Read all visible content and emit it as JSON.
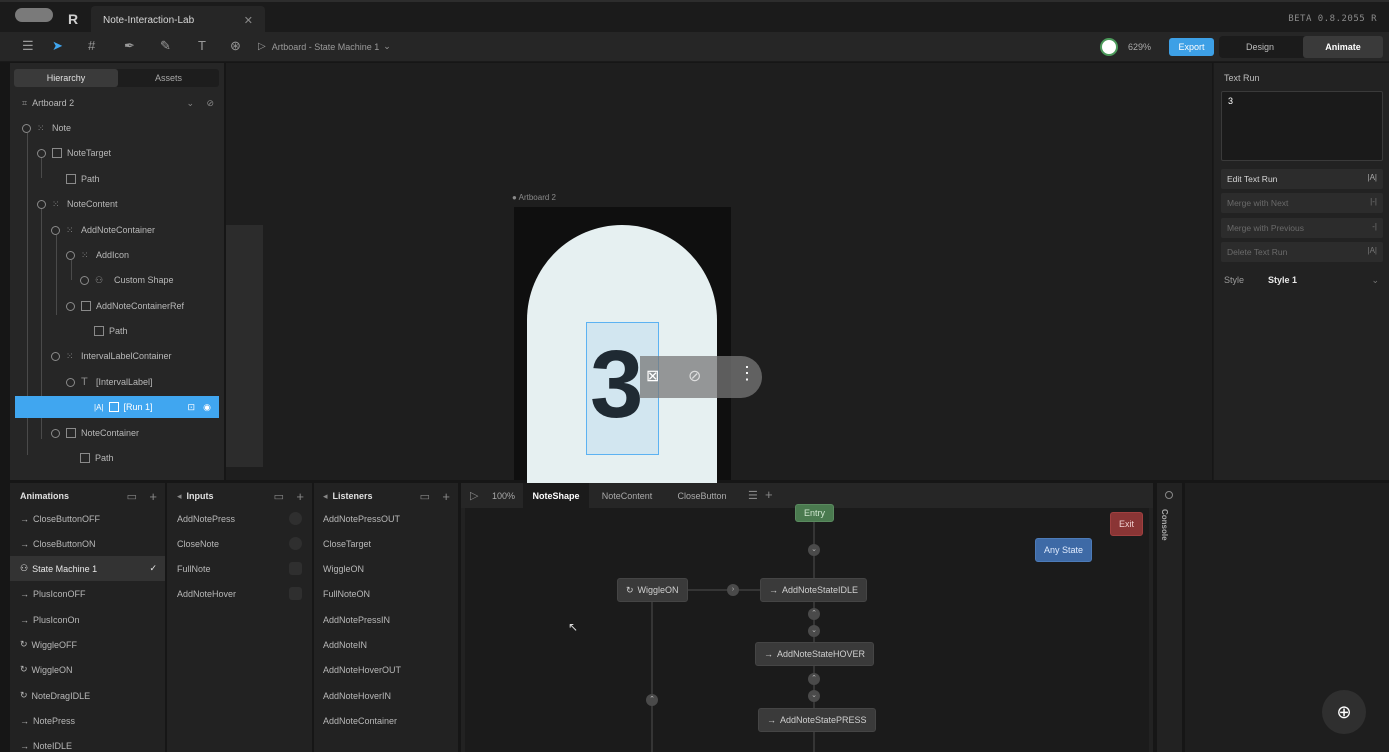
{
  "window": {
    "tab_title": "Note-Interaction-Lab",
    "version": "BETA 0.8.2055 R"
  },
  "toolbar": {
    "breadcrumb": "Artboard - State Machine 1",
    "zoom": "629%",
    "export_label": "Export",
    "mode_design": "Design",
    "mode_animate": "Animate"
  },
  "hierarchy": {
    "tab_hierarchy": "Hierarchy",
    "tab_assets": "Assets",
    "artboard": "Artboard 2",
    "items": [
      {
        "label": "Note"
      },
      {
        "label": "NoteTarget"
      },
      {
        "label": "Path"
      },
      {
        "label": "NoteContent"
      },
      {
        "label": "AddNoteContainer"
      },
      {
        "label": "AddIcon"
      },
      {
        "label": "Custom Shape"
      },
      {
        "label": "AddNoteContainerRef"
      },
      {
        "label": "Path"
      },
      {
        "label": "IntervalLabelContainer"
      },
      {
        "label": "[IntervalLabel]"
      },
      {
        "label": "[Run 1]"
      },
      {
        "label": "NoteContainer"
      },
      {
        "label": "Path"
      }
    ]
  },
  "stage": {
    "artboard_label": "Artboard 2",
    "text_glyph": "3"
  },
  "right_panel": {
    "title": "Text Run",
    "text_value": "3",
    "buttons": [
      "Edit Text Run",
      "Merge with Next",
      "Merge with Previous",
      "Delete Text Run"
    ],
    "style_label": "Style",
    "style_value": "Style 1"
  },
  "animations": {
    "title": "Animations",
    "items": [
      "CloseButtonOFF",
      "CloseButtonON",
      "State Machine 1",
      "PlusIconOFF",
      "PlusIconOn",
      "WiggleOFF",
      "WiggleON",
      "NoteDragIDLE",
      "NotePress",
      "NoteIDLE"
    ]
  },
  "inputs": {
    "title": "Inputs",
    "items": [
      "AddNotePress",
      "CloseNote",
      "FullNote",
      "AddNoteHover"
    ]
  },
  "listeners": {
    "title": "Listeners",
    "items": [
      "AddNotePressOUT",
      "CloseTarget",
      "WiggleON",
      "FullNoteON",
      "AddNotePressIN",
      "AddNoteIN",
      "AddNoteHoverOUT",
      "AddNoteHoverIN",
      "AddNoteContainer"
    ]
  },
  "graph": {
    "zoom": "100%",
    "tabs": [
      "NoteShape",
      "NoteContent",
      "CloseButton"
    ],
    "nodes": {
      "entry": "Entry",
      "exit": "Exit",
      "any_state": "Any State",
      "wiggle_on": "WiggleON",
      "idle": "AddNoteStateIDLE",
      "hover": "AddNoteStateHOVER",
      "press": "AddNoteStatePRESS"
    }
  },
  "console_label": "Console",
  "colors": {
    "accent": "#40a6f0",
    "export": "#3da0e6",
    "entry": "#4a7a4f",
    "exit": "#8a3535",
    "any_state": "#3e6aa6"
  }
}
